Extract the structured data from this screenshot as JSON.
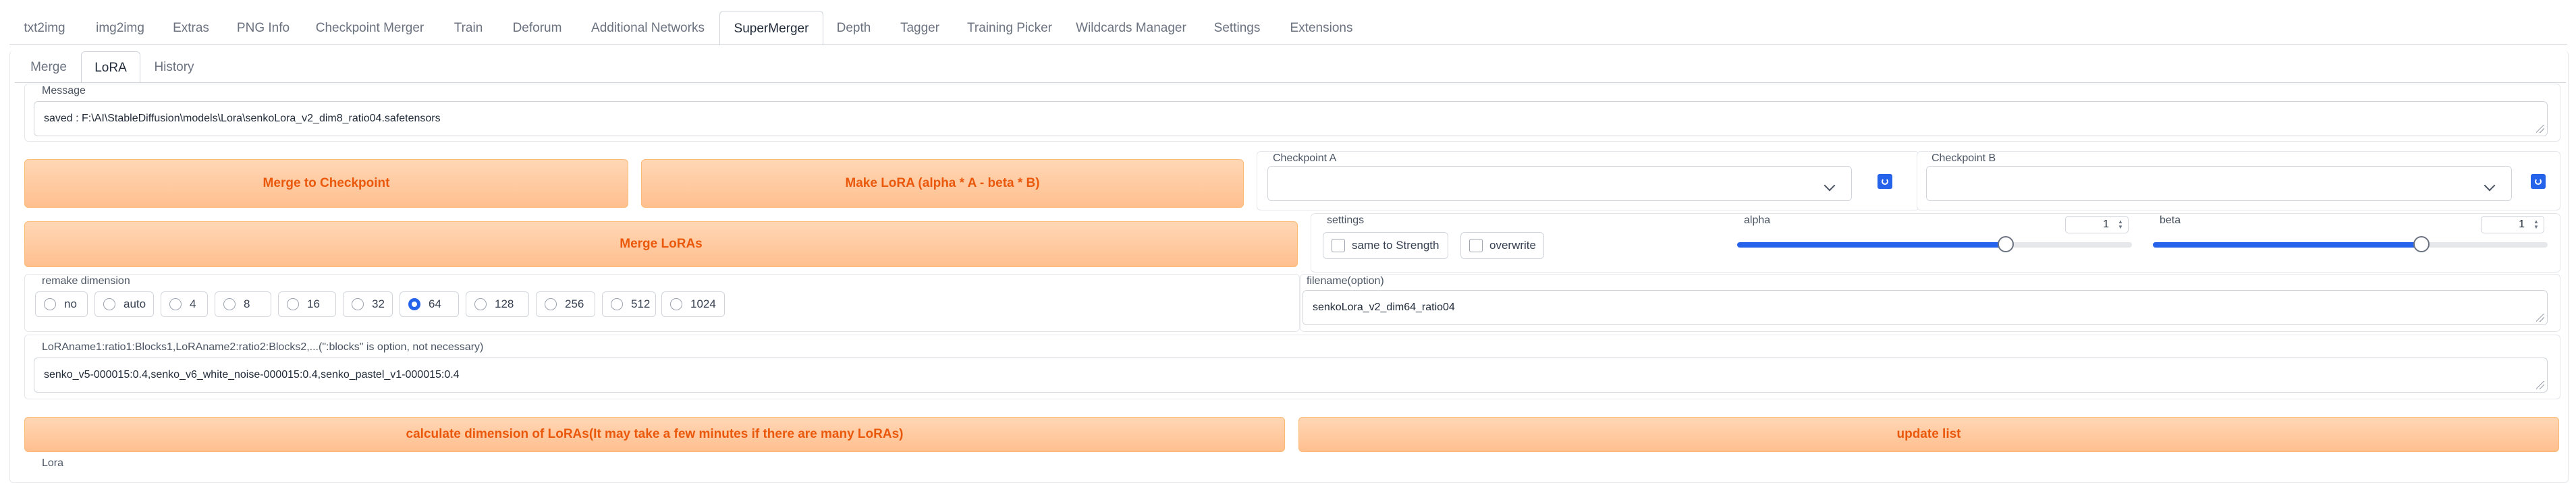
{
  "top_tabs": [
    "txt2img",
    "img2img",
    "Extras",
    "PNG Info",
    "Checkpoint Merger",
    "Train",
    "Deforum",
    "Additional Networks",
    "SuperMerger",
    "Depth",
    "Tagger",
    "Training Picker",
    "Wildcards Manager",
    "Settings",
    "Extensions"
  ],
  "sub_tabs": [
    "Merge",
    "LoRA",
    "History"
  ],
  "message": {
    "label": "Message",
    "value": "saved : F:\\AI\\StableDiffusion\\models\\Lora\\senkoLora_v2_dim8_ratio04.safetensors"
  },
  "buttons": {
    "merge_to_checkpoint": "Merge to Checkpoint",
    "make_lora": "Make LoRA (alpha * A - beta * B)",
    "merge_loras": "Merge LoRAs",
    "calculate_dimension": "calculate dimension of LoRAs(It may take a few minutes if there are many LoRAs)",
    "update_list": "update list"
  },
  "checkpoint_a": {
    "label": "Checkpoint A",
    "value": ""
  },
  "checkpoint_b": {
    "label": "Checkpoint B",
    "value": ""
  },
  "settings": {
    "label": "settings",
    "options": [
      "same to Strength",
      "overwrite"
    ]
  },
  "alpha": {
    "label": "alpha",
    "value": "1",
    "level": 0.68,
    "color": "#2563eb"
  },
  "beta": {
    "label": "beta",
    "value": "1",
    "level": 0.68,
    "color": "#2563eb"
  },
  "remake_dimension": {
    "label": "remake dimension",
    "options": [
      "no",
      "auto",
      "4",
      "8",
      "16",
      "32",
      "64",
      "128",
      "256",
      "512",
      "1024"
    ],
    "selected": "64"
  },
  "filename": {
    "label": "filename(option)",
    "value": "senkoLora_v2_dim64_ratio04"
  },
  "lora_ratios": {
    "label": "LoRAname1:ratio1:Blocks1,LoRAname2:ratio2:Blocks2,...(\":blocks\" is option, not necessary)",
    "value": "senko_v5-000015:0.4,senko_v6_white_noise-000015:0.4,senko_pastel_v1-000015:0.4"
  },
  "bottom_label": "Lora",
  "accent": "#ea580c"
}
